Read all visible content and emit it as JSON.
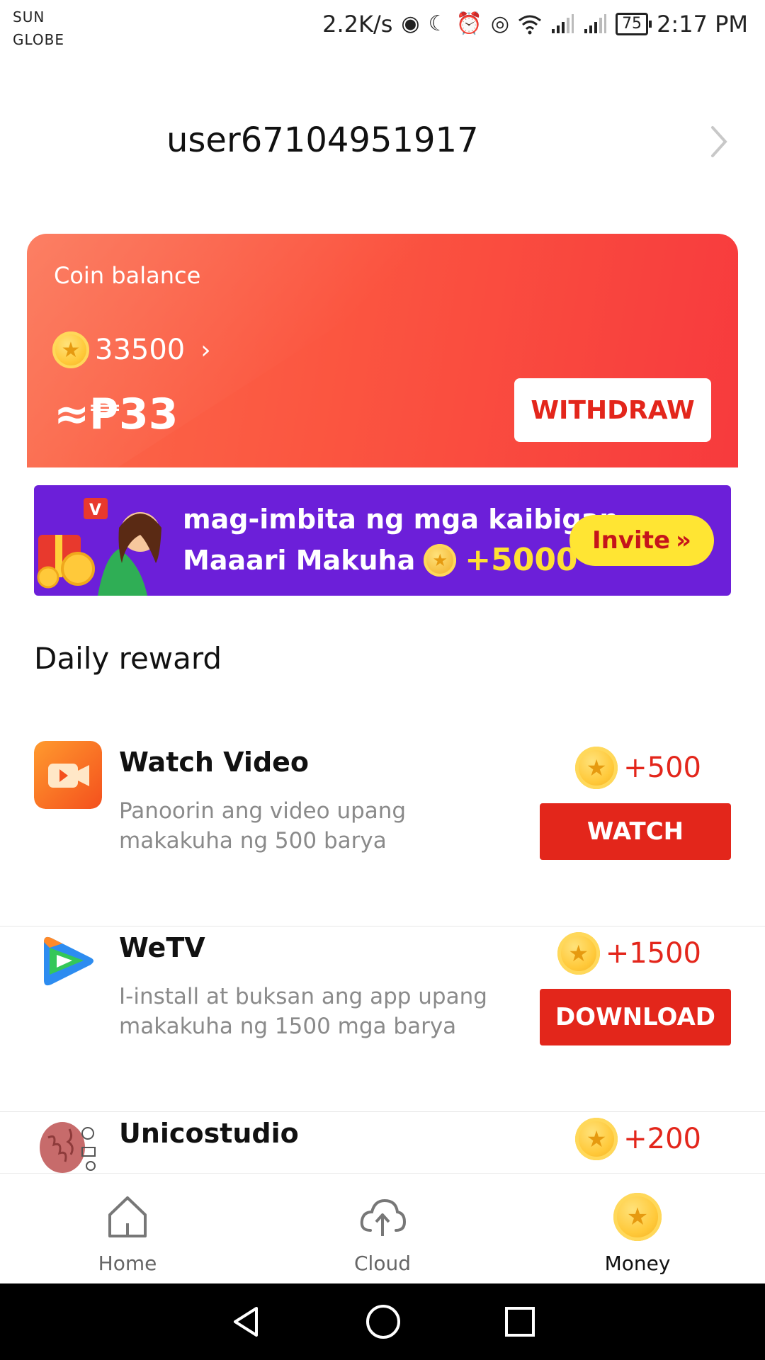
{
  "status_bar": {
    "carrier1": "SUN",
    "carrier2": "GLOBE",
    "speed": "2.2K/s",
    "battery": "75",
    "time": "2:17 PM",
    "icons": [
      "4g-icon",
      "moon-icon",
      "alarm-icon",
      "eye-icon",
      "wifi-icon",
      "signal-icon",
      "signal-icon"
    ]
  },
  "header": {
    "username": "user67104951917"
  },
  "coin_card": {
    "label": "Coin balance",
    "coins": "33500",
    "peso": "≈₱33",
    "withdraw_label": "WITHDRAW",
    "colors": {
      "start": "#fb6a4a",
      "end": "#f73a3d"
    }
  },
  "invite": {
    "line1": "mag-imbita ng mga kaibigan",
    "line2": "Maaari Makuha",
    "bonus": "+5000",
    "button_label": "Invite",
    "button_arrows": "»",
    "bg_color": "#6c1fd9"
  },
  "daily_reward": {
    "title": "Daily reward",
    "tasks": [
      {
        "name": "Watch Video",
        "description": "Panoorin ang video upang makakuha ng 500 barya",
        "reward": "+500",
        "button": "WATCH",
        "icon": "video-camera-icon"
      },
      {
        "name": "WeTV",
        "description": "I-install at buksan ang app upang makakuha ng 1500 mga barya",
        "reward": "+1500",
        "button": "DOWNLOAD",
        "icon": "wetv-play-icon"
      },
      {
        "name": "Unicostudio",
        "description": "",
        "reward": "+200",
        "button": "",
        "icon": "brain-icon"
      }
    ]
  },
  "bottom_nav": {
    "items": [
      {
        "label": "Home",
        "icon": "home-icon",
        "active": false
      },
      {
        "label": "Cloud",
        "icon": "cloud-upload-icon",
        "active": false
      },
      {
        "label": "Money",
        "icon": "coin-icon",
        "active": true
      }
    ]
  },
  "accent_color": "#e3261b"
}
